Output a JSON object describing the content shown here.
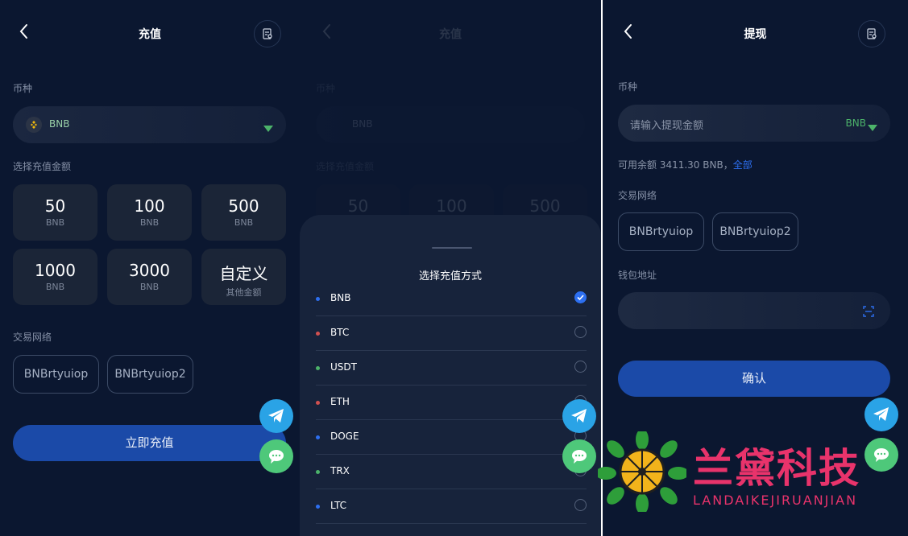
{
  "left": {
    "title": "充值",
    "coin_label": "币种",
    "coin_value": "BNB",
    "amount_label": "选择充值金额",
    "amounts": [
      {
        "value": "50",
        "unit": "BNB"
      },
      {
        "value": "100",
        "unit": "BNB"
      },
      {
        "value": "500",
        "unit": "BNB"
      },
      {
        "value": "1000",
        "unit": "BNB"
      },
      {
        "value": "3000",
        "unit": "BNB"
      },
      {
        "value": "自定义",
        "unit": "其他金额"
      }
    ],
    "network_label": "交易网络",
    "networks": [
      "BNBrtyuiop",
      "BNBrtyuiop2"
    ],
    "submit": "立即充值"
  },
  "middle": {
    "bg_title": "充值",
    "bg_coin_label": "币种",
    "bg_coin_value": "BNB",
    "bg_amount_label": "选择充值金额",
    "bg_amounts": [
      "50",
      "100",
      "500"
    ],
    "sheet_title": "选择充值方式",
    "methods": [
      {
        "name": "BNB",
        "dot": "#2d6ff0",
        "selected": true
      },
      {
        "name": "BTC",
        "dot": "#d05050",
        "selected": false
      },
      {
        "name": "USDT",
        "dot": "#4cb36a",
        "selected": false
      },
      {
        "name": "ETH",
        "dot": "#d05050",
        "selected": false
      },
      {
        "name": "DOGE",
        "dot": "#2d6ff0",
        "selected": false
      },
      {
        "name": "TRX",
        "dot": "#4cb36a",
        "selected": false
      },
      {
        "name": "LTC",
        "dot": "#2d6ff0",
        "selected": false
      }
    ]
  },
  "right": {
    "title": "提现",
    "coin_label": "币种",
    "amount_placeholder": "请输入提现金额",
    "coin_value": "BNB",
    "balance_text": "可用余额 3411.30 BNB，",
    "all_link": "全部",
    "network_label": "交易网络",
    "networks": [
      "BNBrtyuiop",
      "BNBrtyuiop2"
    ],
    "wallet_label": "钱包地址",
    "confirm": "确认"
  },
  "watermark": {
    "name": "兰黛科技",
    "sub": "LANDAIKEJIRUANJIAN"
  },
  "colors": {
    "background": "#0b1730",
    "accent": "#1b4aa8",
    "link": "#2d6ff0",
    "telegram": "#2aa3e6",
    "chat": "#4ec87a",
    "watermark": "#e8336b"
  }
}
